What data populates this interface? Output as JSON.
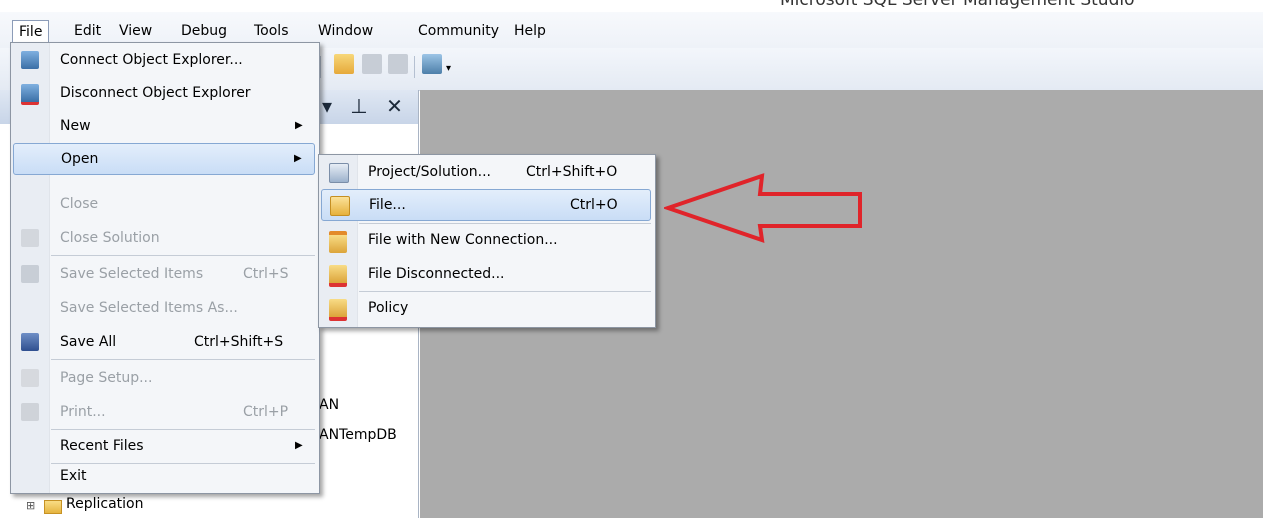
{
  "window": {
    "title": "Microsoft SQL Server Management Studio"
  },
  "menubar": {
    "items": [
      {
        "label": "File"
      },
      {
        "label": "Edit"
      },
      {
        "label": "View"
      },
      {
        "label": "Debug"
      },
      {
        "label": "Tools"
      },
      {
        "label": "Window"
      },
      {
        "label": "Community"
      },
      {
        "label": "Help"
      }
    ]
  },
  "object_explorer": {
    "visible_text": [
      "AN",
      "ANTempDB"
    ],
    "tree_item": {
      "label": "Replication",
      "expander": "⊞"
    },
    "controls": "▾ ⊥ ✕"
  },
  "file_menu": {
    "items": [
      {
        "label": "Connect Object Explorer...",
        "shortcut": "",
        "icon": "connect-icon"
      },
      {
        "label": "Disconnect Object Explorer",
        "shortcut": "",
        "icon": "disconnect-icon"
      },
      {
        "label": "New",
        "shortcut": "",
        "submenu": "▶"
      },
      {
        "label": "Open",
        "shortcut": "",
        "submenu": "▶"
      },
      {
        "label": "Close",
        "shortcut": ""
      },
      {
        "label": "Close Solution",
        "shortcut": "",
        "icon": "close-solution-icon"
      },
      {
        "label": "Save Selected Items",
        "shortcut": "Ctrl+S",
        "icon": "save-icon"
      },
      {
        "label": "Save Selected Items As...",
        "shortcut": ""
      },
      {
        "label": "Save All",
        "shortcut": "Ctrl+Shift+S",
        "icon": "save-all-icon"
      },
      {
        "label": "Page Setup...",
        "shortcut": "",
        "icon": "page-setup-icon"
      },
      {
        "label": "Print...",
        "shortcut": "Ctrl+P",
        "icon": "print-icon"
      },
      {
        "label": "Recent Files",
        "shortcut": "",
        "submenu": "▶"
      },
      {
        "label": "Exit",
        "shortcut": ""
      }
    ]
  },
  "open_submenu": {
    "items": [
      {
        "label": "Project/Solution...",
        "shortcut": "Ctrl+Shift+O",
        "icon": "project-solution-icon"
      },
      {
        "label": "File...",
        "shortcut": "Ctrl+O",
        "icon": "open-folder-icon"
      },
      {
        "label": "File with New Connection...",
        "shortcut": "",
        "icon": "file-new-connection-icon"
      },
      {
        "label": "File Disconnected...",
        "shortcut": "",
        "icon": "file-disconnected-icon"
      },
      {
        "label": "Policy",
        "shortcut": "",
        "icon": "policy-icon"
      }
    ]
  },
  "colors": {
    "highlight": "#c9ddf6",
    "doc_background": "#ababab",
    "annotation_arrow": "#e0242a"
  }
}
